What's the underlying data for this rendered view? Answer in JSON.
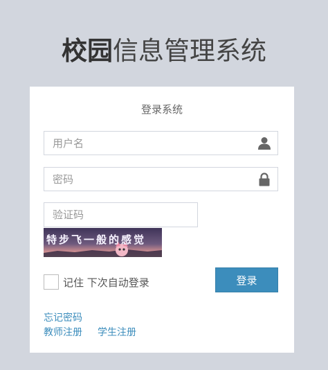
{
  "header": {
    "title_bold": "校园",
    "title_rest": "信息管理系统"
  },
  "login": {
    "heading": "登录系统",
    "username_placeholder": "用户名",
    "password_placeholder": "密码",
    "captcha_placeholder": "验证码",
    "captcha_text": "特步飞一般的感觉",
    "remember_label": "记住 下次自动登录",
    "submit_label": "登录",
    "forgot_password": "忘记密码",
    "teacher_register": "教师注册",
    "student_register": "学生注册"
  },
  "icons": {
    "username": "user-icon",
    "password": "lock-icon"
  },
  "colors": {
    "background": "#d2d6de",
    "accent": "#3c8dbc"
  }
}
